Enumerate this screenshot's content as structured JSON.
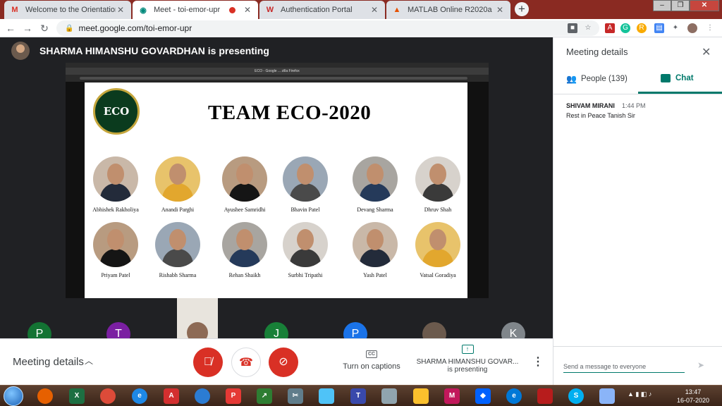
{
  "browser": {
    "tabs": [
      {
        "label": "Welcome to the Orientation Prog",
        "icon": "gmail-icon",
        "active": false
      },
      {
        "label": "Meet - toi-emor-upr",
        "icon": "google-meet-icon",
        "active": true,
        "recording": true
      },
      {
        "label": "Authentication Portal",
        "icon": "portal-icon",
        "active": false
      },
      {
        "label": "MATLAB Online R2020a",
        "icon": "matlab-icon",
        "active": false
      }
    ],
    "new_tab": "+",
    "address": "meet.google.com/toi-emor-upr"
  },
  "meet": {
    "presenter_banner": "SHARMA HIMANSHU GOVARDHAN is presenting",
    "inner_window_tab": "ECO - Google ... zilla Firefox",
    "slide": {
      "title": "TEAM ECO-2020",
      "logo_text": "ECO",
      "members_row1": [
        "Abhishek Rakholiya",
        "Anandi Parghi",
        "Ayushee Samridhi",
        "Bhavin Patel",
        "Devang Sharma",
        "Dhruv Shah"
      ],
      "members_row2": [
        "Priyam Patel",
        "Rishabh Sharma",
        "Rehan Shaikh",
        "Surbhi Tripathi",
        "Yash Patel",
        "Vatsal Goradiya"
      ]
    },
    "participants": [
      {
        "initial": "P",
        "color": "#137333"
      },
      {
        "initial": "T",
        "color": "#7b1fa2"
      },
      {
        "initial": "J",
        "color": "#188038"
      },
      {
        "initial": "P",
        "color": "#1a73e8"
      },
      {
        "initial": "K",
        "color": "#80868b"
      }
    ],
    "bottom": {
      "meeting_details": "Meeting details",
      "captions": "Turn on captions",
      "captions_icon": "CC",
      "presenter_line1": "SHARMA HIMANSHU GOVAR...",
      "presenter_line2": "is presenting"
    }
  },
  "panel": {
    "title": "Meeting details",
    "people_tab": "People (139)",
    "chat_tab": "Chat",
    "messages": [
      {
        "sender": "SHIVAM MIRANI",
        "time": "1:44 PM",
        "text": "Rest in Peace Tanish Sir"
      }
    ],
    "input_placeholder": "Send a message to everyone"
  },
  "taskbar": {
    "clock_time": "13:47",
    "clock_date": "16-07-2020"
  },
  "colors": {
    "accent": "#00796b",
    "danger": "#d93025"
  }
}
